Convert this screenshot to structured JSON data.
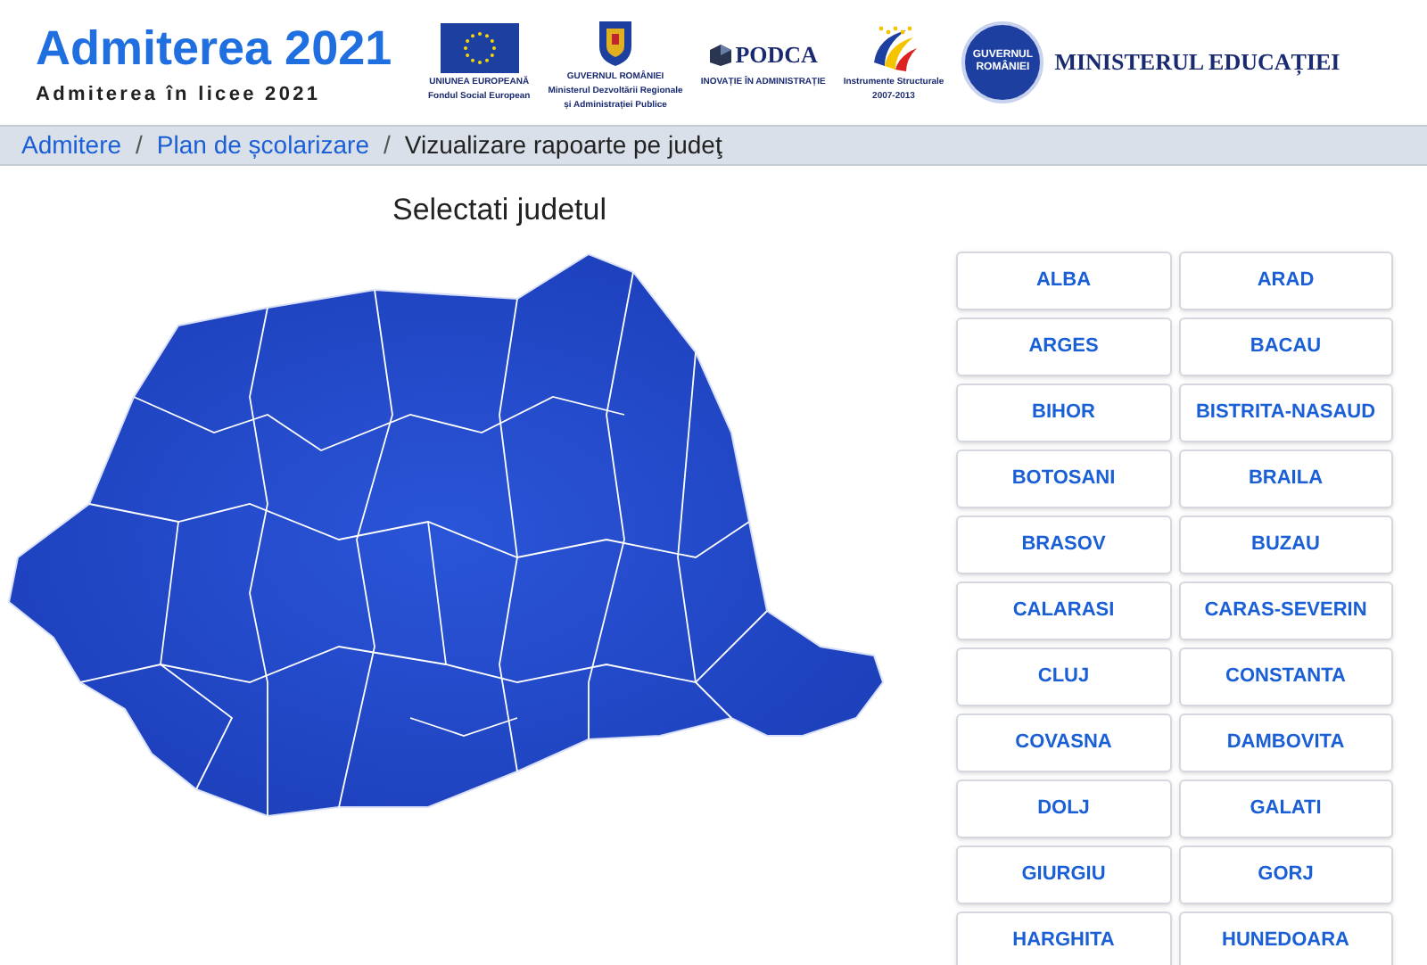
{
  "header": {
    "title": "Admiterea 2021",
    "subtitle": "Admiterea în licee 2021",
    "logos": [
      {
        "kind": "eu",
        "lines": [
          "UNIUNEA EUROPEANĂ",
          "Fondul Social European"
        ]
      },
      {
        "kind": "crest",
        "lines": [
          "GUVERNUL ROMÂNIEI",
          "Ministerul Dezvoltării Regionale",
          "și Administrației Publice"
        ]
      },
      {
        "kind": "podca",
        "name": "PODCA",
        "lines": [
          "INOVAȚIE ÎN ADMINISTRAȚIE"
        ]
      },
      {
        "kind": "stars",
        "lines": [
          "Instrumente Structurale",
          "2007-2013"
        ]
      }
    ],
    "ministry": {
      "seal": "GUVERNUL ROMÂNIEI",
      "name": "MINISTERUL EDUCAȚIEI"
    }
  },
  "breadcrumb_separator": "/",
  "breadcrumb": [
    {
      "label": "Admitere",
      "link": true
    },
    {
      "label": "Plan de școlarizare",
      "link": true
    },
    {
      "label": "Vizualizare rapoarte pe judeţ",
      "link": false
    }
  ],
  "map_title": "Selectati judetul",
  "counties": [
    "ALBA",
    "ARAD",
    "ARGES",
    "BACAU",
    "BIHOR",
    "BISTRITA-NASAUD",
    "BOTOSANI",
    "BRAILA",
    "BRASOV",
    "BUZAU",
    "CALARASI",
    "CARAS-SEVERIN",
    "CLUJ",
    "CONSTANTA",
    "COVASNA",
    "DAMBOVITA",
    "DOLJ",
    "GALATI",
    "GIURGIU",
    "GORJ",
    "HARGHITA",
    "HUNEDOARA"
  ]
}
